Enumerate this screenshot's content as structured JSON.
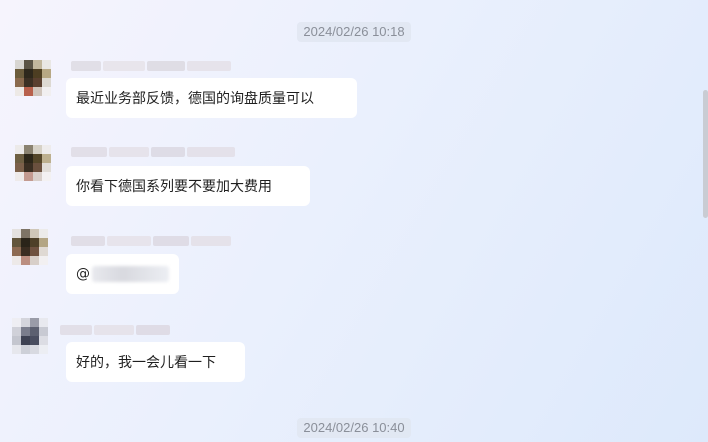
{
  "timestamps": [
    "2024/02/26 10:18",
    "2024/02/26 10:40"
  ],
  "messages": [
    {
      "text": "最近业务部反馈，德国的询盘质量可以"
    },
    {
      "text": "你看下德国系列要不要加大费用"
    },
    {
      "text": "@"
    },
    {
      "text": "好的，我一会儿看一下"
    }
  ]
}
